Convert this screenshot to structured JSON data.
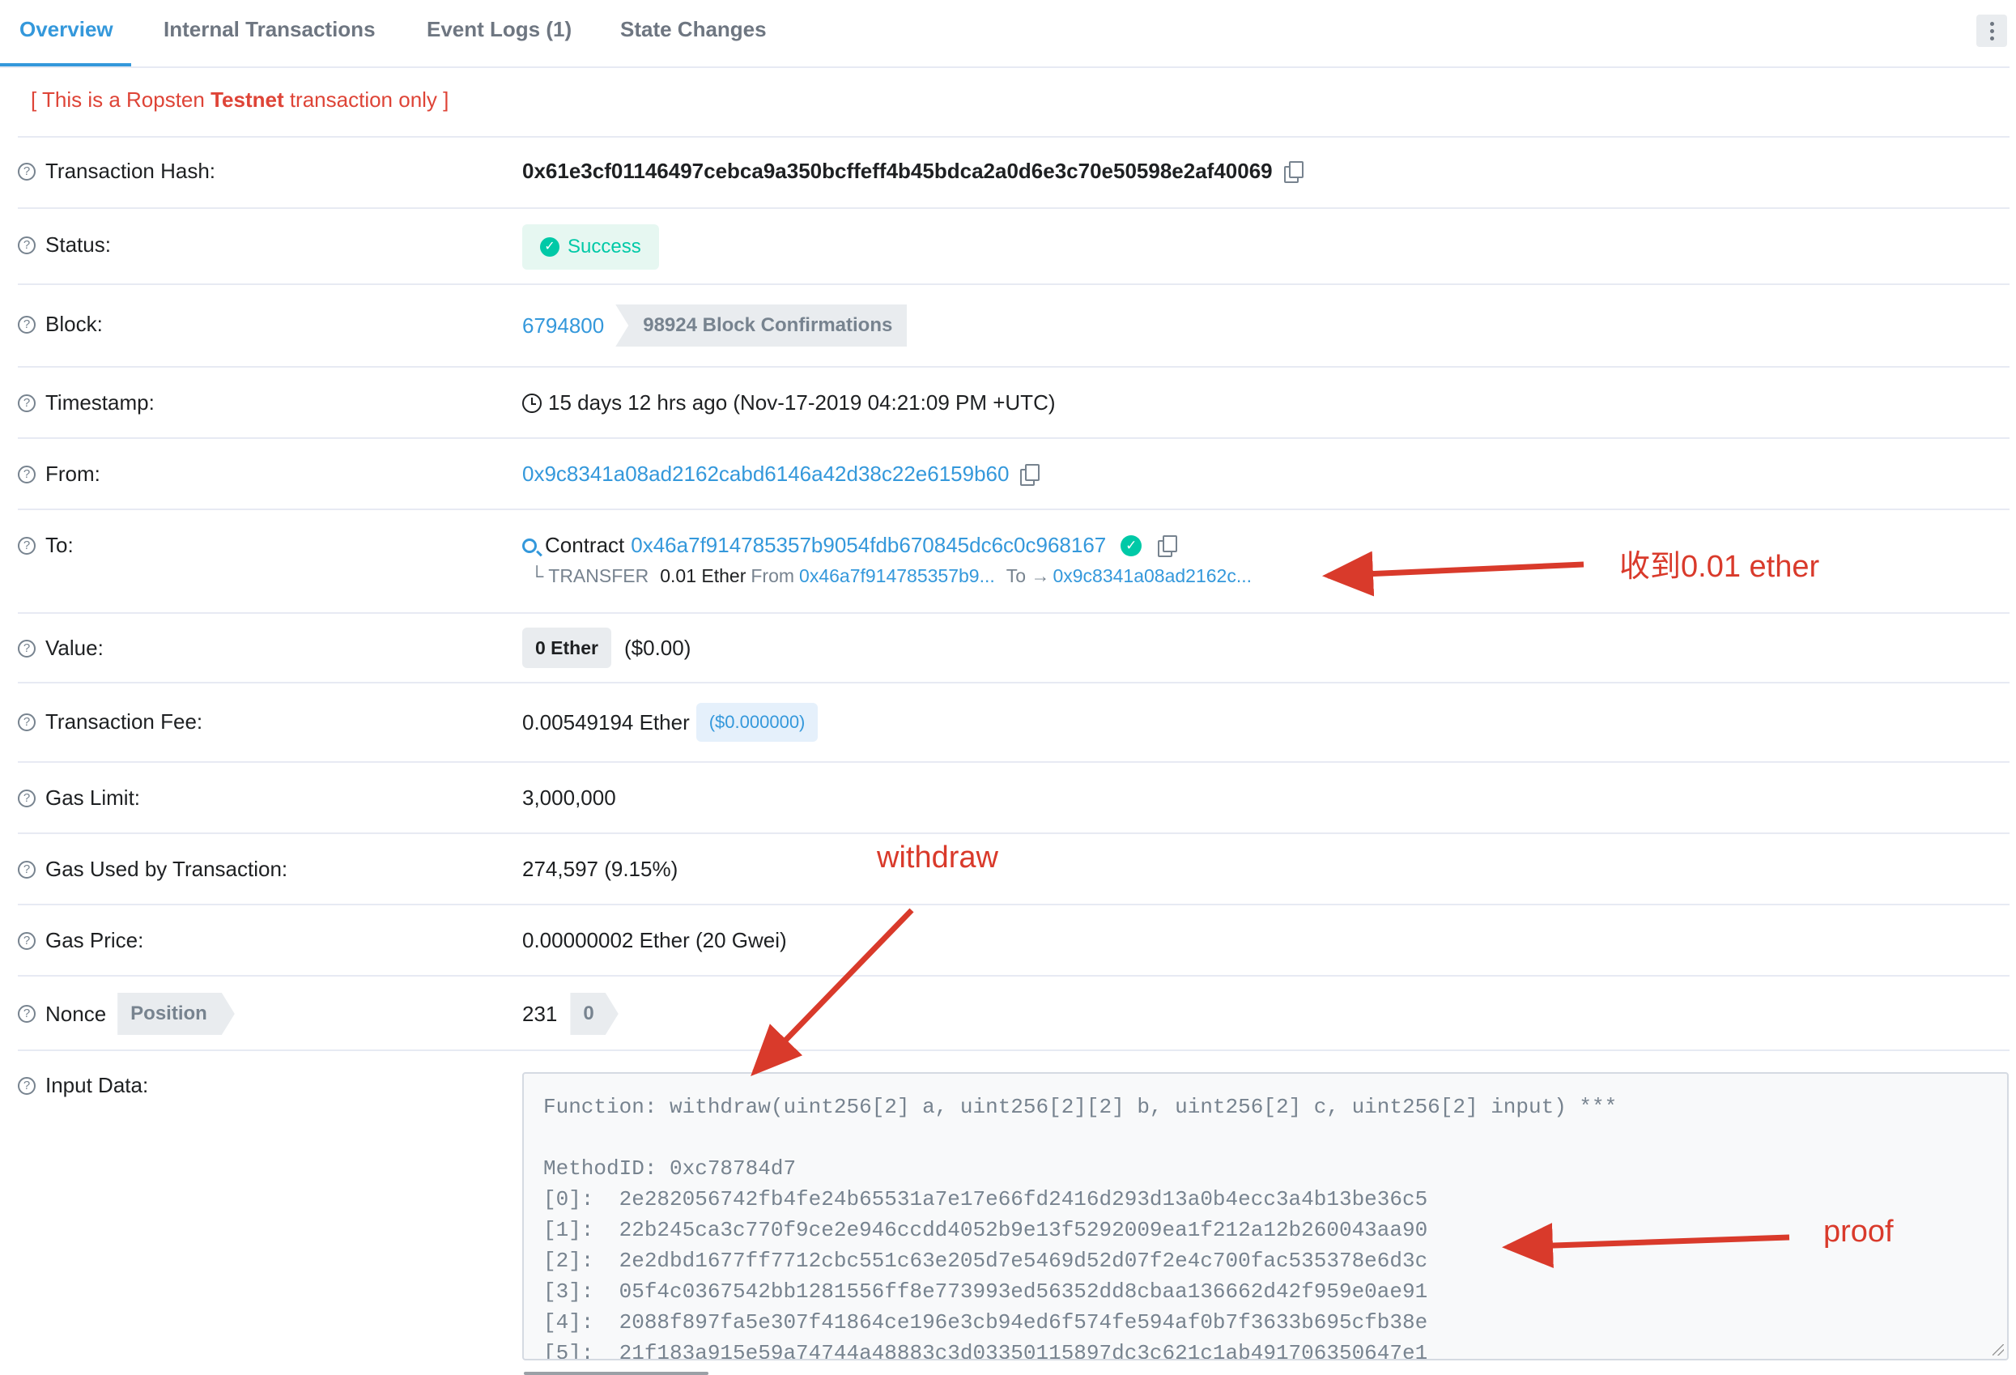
{
  "tabs": {
    "overview": "Overview",
    "internal": "Internal Transactions",
    "events": "Event Logs (1)",
    "state": "State Changes"
  },
  "testnet_notice": {
    "prefix": "[ This is a Ropsten ",
    "bold": "Testnet",
    "suffix": " transaction only ]"
  },
  "fields": {
    "hash": {
      "label": "Transaction Hash:",
      "value": "0x61e3cf01146497cebca9a350bcffeff4b45bdca2a0d6e3c70e50598e2af40069"
    },
    "status": {
      "label": "Status:",
      "value": "Success"
    },
    "block": {
      "label": "Block:",
      "value": "6794800",
      "confirmations": "98924 Block Confirmations"
    },
    "timestamp": {
      "label": "Timestamp:",
      "value": "15 days 12 hrs ago (Nov-17-2019 04:21:09 PM +UTC)"
    },
    "from": {
      "label": "From:",
      "value": "0x9c8341a08ad2162cabd6146a42d38c22e6159b60"
    },
    "to": {
      "label": "To:",
      "contract_word": "Contract",
      "value": "0x46a7f914785357b9054fdb670845dc6c0c968167",
      "transfer": {
        "prefix": "└ TRANSFER",
        "amount": "0.01 Ether",
        "from_word": "From",
        "from_addr": "0x46a7f914785357b9...",
        "to_word": "To →",
        "to_addr": "0x9c8341a08ad2162c..."
      }
    },
    "value": {
      "label": "Value:",
      "ether": "0 Ether",
      "usd": "($0.00)"
    },
    "fee": {
      "label": "Transaction Fee:",
      "value": "0.00549194 Ether",
      "usd": "($0.000000)"
    },
    "gas_limit": {
      "label": "Gas Limit:",
      "value": "3,000,000"
    },
    "gas_used": {
      "label": "Gas Used by Transaction:",
      "value": "274,597 (9.15%)"
    },
    "gas_price": {
      "label": "Gas Price:",
      "value": "0.00000002 Ether (20 Gwei)"
    },
    "nonce": {
      "label": "Nonce",
      "position_badge": "Position",
      "value": "231",
      "position": "0"
    },
    "input": {
      "label": "Input Data:",
      "function": "Function: withdraw(uint256[2] a, uint256[2][2] b, uint256[2] c, uint256[2] input) ***",
      "method": "MethodID: 0xc78784d7",
      "params": [
        "[0]:  2e282056742fb4fe24b65531a7e17e66fd2416d293d13a0b4ecc3a4b13be36c5",
        "[1]:  22b245ca3c770f9ce2e946ccdd4052b9e13f5292009ea1f212a12b260043aa90",
        "[2]:  2e2dbd1677ff7712cbc551c63e205d7e5469d52d07f2e4c700fac535378e6d3c",
        "[3]:  05f4c0367542bb1281556ff8e773993ed56352dd8cbaa136662d42f959e0ae91",
        "[4]:  2088f897fa5e307f41864ce196e3cb94ed6f574fe594af0b7f3633b695cfb38e",
        "[5]:  21f183a915e59a74744a48883c3d03350115897dc3c621c1ab491706350647e1"
      ]
    }
  },
  "annotations": {
    "received": "收到0.01 ether",
    "withdraw": "withdraw",
    "proof": "proof",
    "color": "#d93a2b"
  },
  "colors": {
    "link": "#3498db",
    "success": "#00c9a7",
    "testnet": "#de4437"
  },
  "icons": [
    "question-icon",
    "copy-icon",
    "check-circle-icon",
    "clock-icon",
    "search-icon",
    "verified-icon",
    "more-vertical-icon"
  ]
}
